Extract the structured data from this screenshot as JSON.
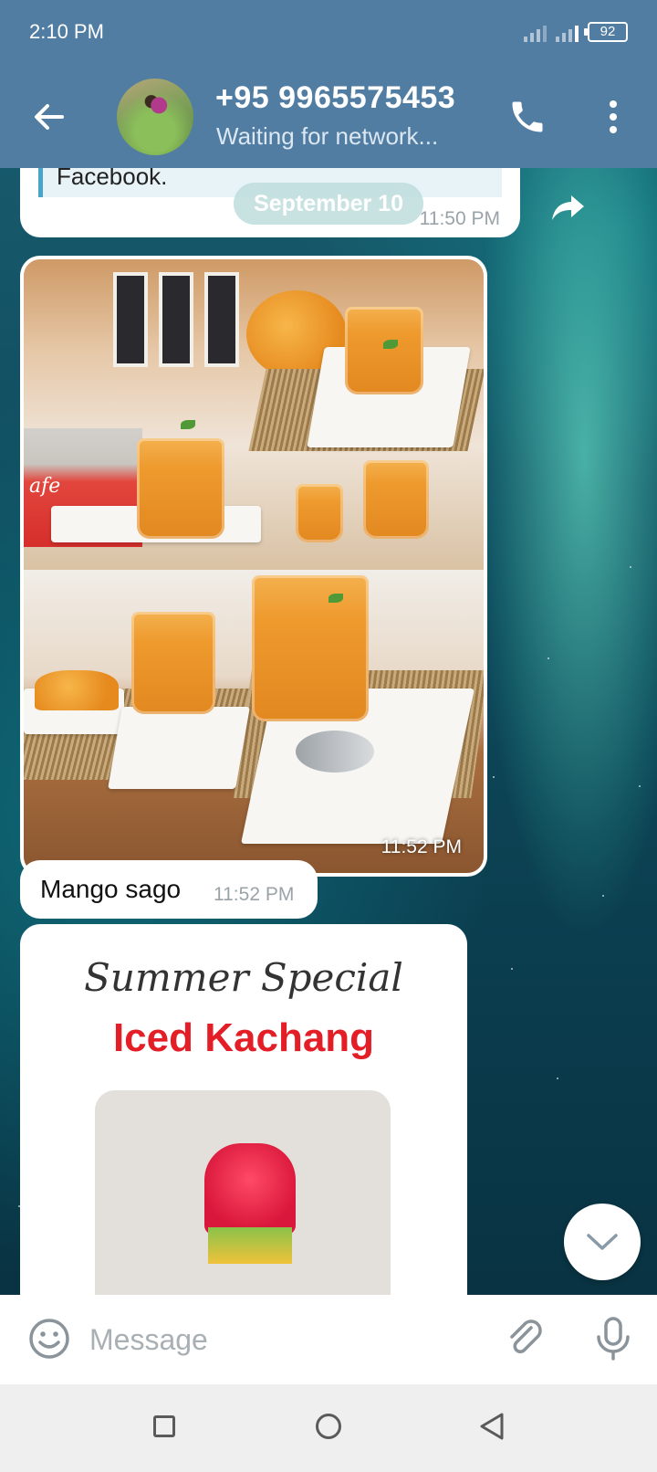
{
  "status_bar": {
    "time": "2:10 PM",
    "battery": "92"
  },
  "header": {
    "contact_name": "+95 9965575453",
    "contact_status": "Waiting for network...",
    "icons": [
      "back-arrow-icon",
      "phone-icon",
      "more-vert-icon"
    ],
    "background_color": "#517da2"
  },
  "messages": {
    "quoted": {
      "text": "Facebook.",
      "time": "11:50 PM"
    },
    "date_separator": "September 10",
    "photo": {
      "time": "11:52 PM",
      "cafe_sign": "afe"
    },
    "text_message": {
      "text": "Mango sago",
      "time": "11:52 PM"
    },
    "poster": {
      "subtitle": "Summer Special",
      "title": "Iced Kachang"
    }
  },
  "composer": {
    "placeholder": "Message",
    "icons": [
      "emoji-icon",
      "attach-icon",
      "mic-icon"
    ]
  },
  "nav_bar": {
    "icons": [
      "recent-apps-icon",
      "home-icon",
      "back-icon"
    ]
  }
}
